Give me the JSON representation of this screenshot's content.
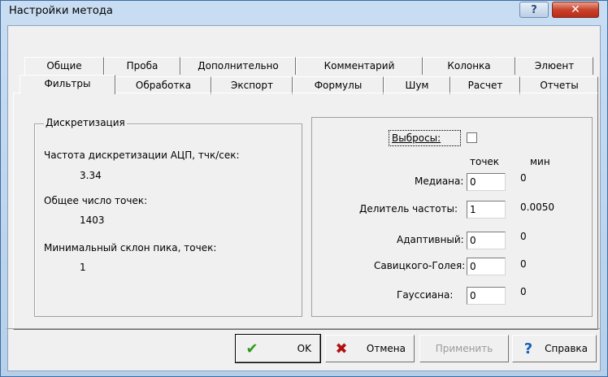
{
  "window": {
    "title": "Настройки метода",
    "help_glyph": "?",
    "close_glyph": "✕"
  },
  "tabs_row1": [
    "Общие",
    "Проба",
    "Дополнительно",
    "Комментарий",
    "Колонка",
    "Элюент"
  ],
  "tabs_row2": [
    "Фильтры",
    "Обработка",
    "Экспорт",
    "Формулы",
    "Шум",
    "Расчет",
    "Отчеты"
  ],
  "active_tab": "Фильтры",
  "discretization": {
    "title": "Дискретизация",
    "adc_rate_label": "Частота дискретизации АЦП, тчк/сек:",
    "adc_rate_value": "3.34",
    "total_points_label": "Общее число точек:",
    "total_points_value": "1403",
    "min_slope_label": "Минимальный склон пика, точек:",
    "min_slope_value": "1"
  },
  "filters": {
    "outliers_label": "Выбросы:",
    "col_points": "точек",
    "col_min": "мин",
    "rows": [
      {
        "label": "Медиана:",
        "value": "0",
        "min": "0"
      },
      {
        "label": "Делитель частоты:",
        "value": "1",
        "min": "0.0050"
      },
      {
        "label": "Адаптивный:",
        "value": "0",
        "min": "0"
      },
      {
        "label": "Савицкого-Голея:",
        "value": "0",
        "min": "0"
      },
      {
        "label": "Гауссиана:",
        "value": "0",
        "min": "0"
      }
    ]
  },
  "buttons": {
    "ok": "OK",
    "cancel": "Отмена",
    "apply": "Применить",
    "help": "Справка"
  }
}
